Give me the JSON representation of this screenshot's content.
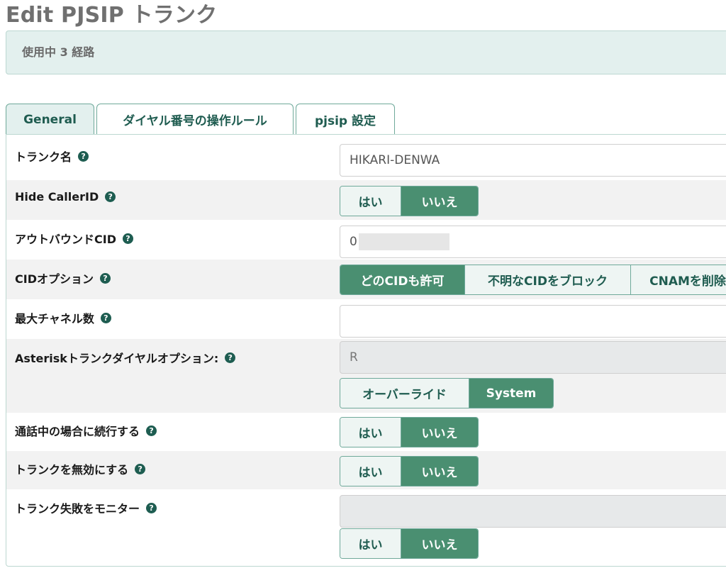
{
  "page_title": "Edit PJSIP トランク",
  "usage_text": "使用中 3 経路",
  "tabs": [
    {
      "label": "General",
      "active": true
    },
    {
      "label": "ダイヤル番号の操作ルール",
      "active": false
    },
    {
      "label": "pjsip 設定",
      "active": false
    }
  ],
  "help_icon_glyph": "?",
  "fields": {
    "trunk_name": {
      "label": "トランク名",
      "value": "HIKARI-DENWA"
    },
    "hide_callerid": {
      "label": "Hide CallerID",
      "yes": "はい",
      "no": "いいえ",
      "selected": "いいえ"
    },
    "outbound_cid": {
      "label": "アウトバウンドCID",
      "value": "0"
    },
    "cid_options": {
      "label": "CIDオプション",
      "options": [
        "どのCIDも許可",
        "不明なCIDをブロック",
        "CNAMを削除"
      ],
      "selected": "どのCIDも許可"
    },
    "max_channels": {
      "label": "最大チャネル数",
      "value": ""
    },
    "dial_options": {
      "label": "Asteriskトランクダイヤルオプション:",
      "value": "R",
      "override": "オーバーライド",
      "system": "System",
      "selected": "System"
    },
    "continue_if_busy": {
      "label": "通話中の場合に続行する",
      "yes": "はい",
      "no": "いいえ",
      "selected": "いいえ"
    },
    "disable_trunk": {
      "label": "トランクを無効にする",
      "yes": "はい",
      "no": "いいえ",
      "selected": "いいえ"
    },
    "monitor_failures": {
      "label": "トランク失敗をモニター",
      "value": "",
      "yes": "はい",
      "no": "いいえ",
      "selected": "いいえ"
    }
  },
  "colors": {
    "accent": "#4a8f71",
    "help_icon": "#1e5d51",
    "tab_border": "#6fa99a",
    "usage_bg": "#e3f0ee"
  }
}
